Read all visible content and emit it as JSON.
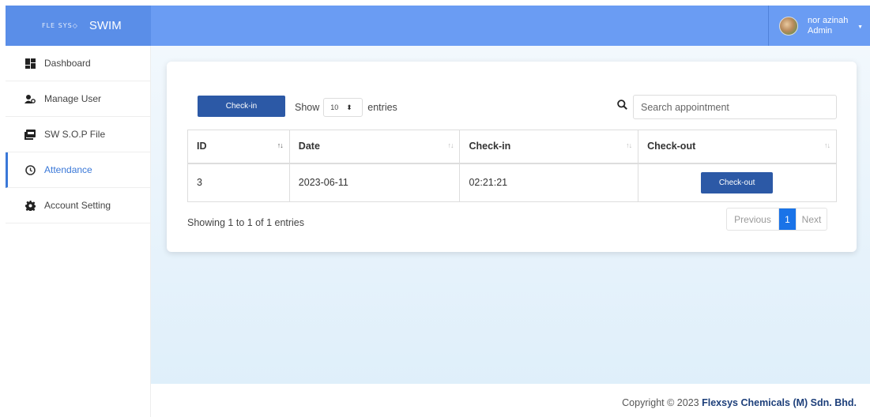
{
  "brand": {
    "logo_text": "FLE SYS◇",
    "app_name": "SWIM"
  },
  "user": {
    "name": "nor azinah",
    "role": "Admin"
  },
  "sidebar": {
    "items": [
      {
        "label": "Dashboard",
        "icon": "dashboard-icon",
        "active": false
      },
      {
        "label": "Manage User",
        "icon": "users-icon",
        "active": false
      },
      {
        "label": "SW S.O.P File",
        "icon": "file-pdf-icon",
        "active": false
      },
      {
        "label": "Attendance",
        "icon": "clock-icon",
        "active": true
      },
      {
        "label": "Account Setting",
        "icon": "gear-icon",
        "active": false
      }
    ]
  },
  "toolbar": {
    "checkin_label": "Check-in",
    "show_label": "Show",
    "entries_value": "10",
    "entries_label": "entries",
    "search_placeholder": "Search appointment"
  },
  "table": {
    "columns": [
      "ID",
      "Date",
      "Check-in",
      "Check-out"
    ],
    "rows": [
      {
        "id": "3",
        "date": "2023-06-11",
        "checkin": "02:21:21",
        "checkout_button": "Check-out"
      }
    ]
  },
  "pagination": {
    "info": "Showing 1 to 1 of 1 entries",
    "previous": "Previous",
    "current_page": "1",
    "next": "Next"
  },
  "footer": {
    "prefix": "Copyright © 2023",
    "company": "Flexsys Chemicals (M) Sdn. Bhd."
  },
  "colors": {
    "topbar": "#6a9cf3",
    "primary_button": "#2c59a6",
    "active_link": "#3a78d8",
    "page_active": "#1a73e8"
  }
}
